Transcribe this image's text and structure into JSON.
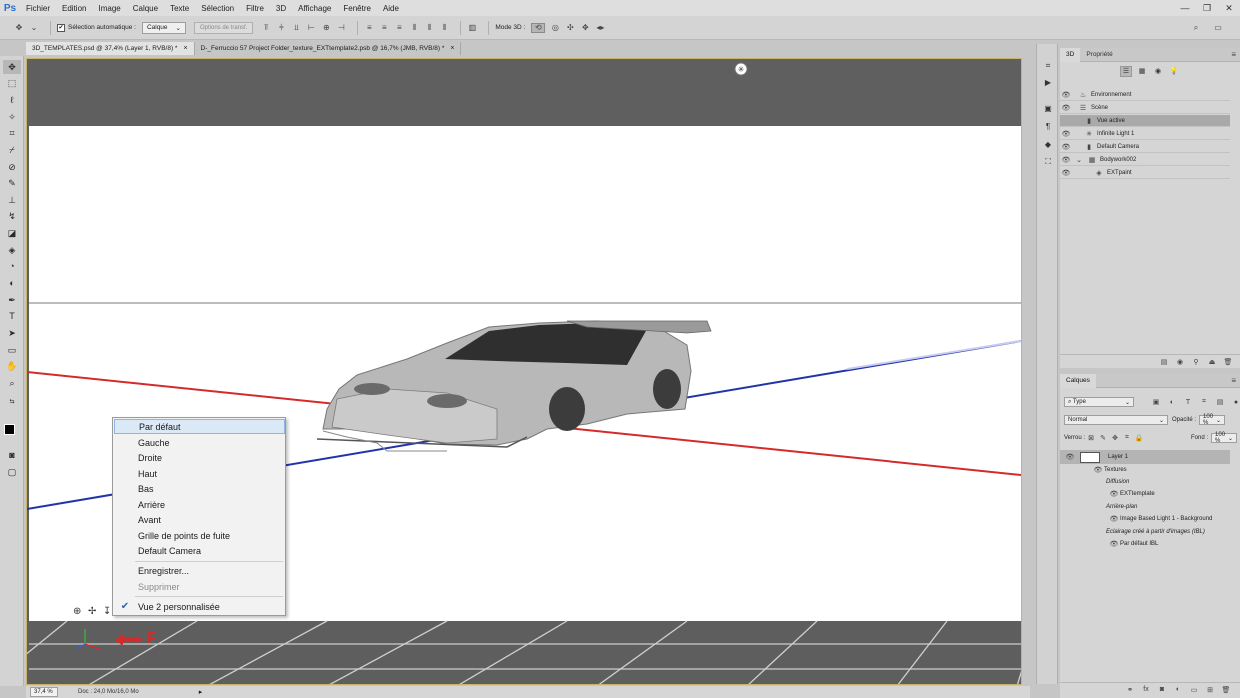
{
  "app": {
    "logo": "Ps"
  },
  "menubar": {
    "items": [
      "Fichier",
      "Edition",
      "Image",
      "Calque",
      "Texte",
      "Sélection",
      "Filtre",
      "3D",
      "Affichage",
      "Fenêtre",
      "Aide"
    ]
  },
  "window_controls": [
    "—",
    "❐",
    "✕"
  ],
  "options_bar": {
    "auto_select_label": "Sélection automatique :",
    "auto_select_value": "Calque",
    "transform_options": "Options de transf.",
    "mode3d_label": "Mode 3D :"
  },
  "tabs": [
    {
      "label": "3D_TEMPLATES.psd @ 37,4% (Layer 1, RVB/8) *",
      "close": "×"
    },
    {
      "label": "D-_Ferruccio 57 Project Folder_texture_EXTtemplate2.psb @ 16,7% (JMB, RVB/8) *",
      "close": "×"
    }
  ],
  "context_menu": {
    "items": [
      {
        "label": "Par défaut",
        "state": "highlighted"
      },
      {
        "label": "Gauche"
      },
      {
        "label": "Droite"
      },
      {
        "label": "Haut"
      },
      {
        "label": "Bas"
      },
      {
        "label": "Arrière"
      },
      {
        "label": "Avant"
      },
      {
        "label": "Grille de points de fuite"
      },
      {
        "label": "Default Camera"
      },
      {
        "label": "Enregistrer..."
      },
      {
        "label": "Supprimer",
        "state": "disabled"
      },
      {
        "label": "Vue 2 personnalisée",
        "checked": true
      }
    ],
    "check_glyph": "✔"
  },
  "canvas": {
    "annotation": "F",
    "bg_colors": {
      "top": "#5f5f5f",
      "viewport": "#ffffff",
      "floor": "#5e5e5e"
    },
    "axis_colors": {
      "x": "#d42a2a",
      "z": "#2233aa"
    }
  },
  "status_bar": {
    "zoom": "37,4 %",
    "doc_info": "Doc : 24,0 Mo/16,0 Mo"
  },
  "panel_3d": {
    "tabs": [
      "3D",
      "Propriété"
    ],
    "tree": [
      {
        "label": "Environnement",
        "icon": "environment-icon"
      },
      {
        "label": "Scène",
        "icon": "scene-icon"
      },
      {
        "label": "Vue active",
        "icon": "camera-icon",
        "selected": true
      },
      {
        "label": "Infinite Light 1",
        "icon": "light-icon"
      },
      {
        "label": "Default Camera",
        "icon": "camera-icon"
      },
      {
        "label": "Bodywork002",
        "icon": "mesh-icon"
      },
      {
        "label": "EXTpaint",
        "icon": "material-icon"
      }
    ]
  },
  "panel_layers": {
    "tab": "Calques",
    "filter_label": "Type",
    "blend_mode": "Normal",
    "opacity_label": "Opacité :",
    "opacity_value": "100 %",
    "lock_label": "Verrou :",
    "fill_label": "Fond :",
    "fill_value": "100 %",
    "layer_name": "Layer 1",
    "sub_items": [
      {
        "label": "Textures",
        "indent": 1,
        "eye": true
      },
      {
        "label": "Diffusion",
        "indent": 2,
        "italic": true
      },
      {
        "label": "EXTtemplate",
        "indent": 3,
        "eye": true
      },
      {
        "label": "Arrière-plan",
        "indent": 2,
        "italic": true
      },
      {
        "label": "Image Based Light 1 - Background",
        "indent": 3,
        "eye": true
      },
      {
        "label": "Eclairage créé à partir d'images (IBL)",
        "indent": 2,
        "italic": true
      },
      {
        "label": "Par défaut IBL",
        "indent": 3,
        "eye": true
      }
    ]
  }
}
